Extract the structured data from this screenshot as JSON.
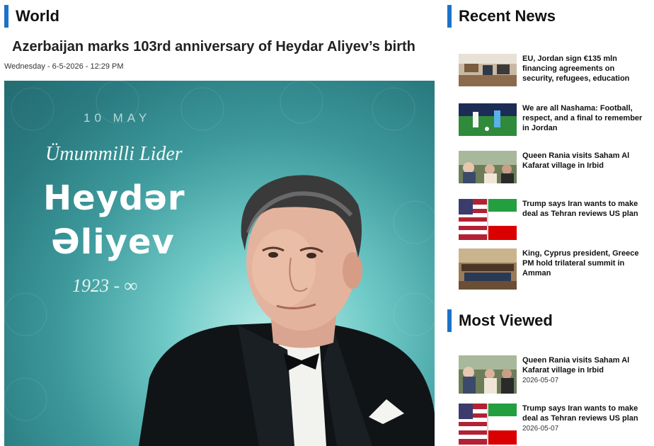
{
  "world_section": {
    "title": "World"
  },
  "article": {
    "headline": "Azerbaijan marks 103rd anniversary of Heydar Aliyev’s birth",
    "dateline": "Wednesday - 6-5-2026 - 12:29 PM",
    "image_text": {
      "date": "10 MAY",
      "script": "Ümummilli Lider",
      "name_line1": "Heydər",
      "name_line2": "Əliyev",
      "years": "1923 - ∞"
    }
  },
  "recent_news": {
    "title": "Recent News",
    "items": [
      {
        "title": "EU, Jordan sign €135 mln financing agreements on security, refugees, education"
      },
      {
        "title": "We are all Nashama: Football, respect, and a final to remember in Jordan"
      },
      {
        "title": "Queen Rania visits Saham Al Kafarat village in Irbid"
      },
      {
        "title": "Trump says Iran wants to make deal as Tehran reviews US plan"
      },
      {
        "title": "King, Cyprus president, Greece PM hold trilateral summit in Amman"
      }
    ]
  },
  "most_viewed": {
    "title": "Most Viewed",
    "items": [
      {
        "title": "Queen Rania visits Saham Al Kafarat village in Irbid",
        "date": "2026-05-07"
      },
      {
        "title": "Trump says Iran wants to make deal as Tehran reviews US plan",
        "date": "2026-05-07"
      }
    ]
  },
  "colors": {
    "accent": "#1b73c9"
  }
}
